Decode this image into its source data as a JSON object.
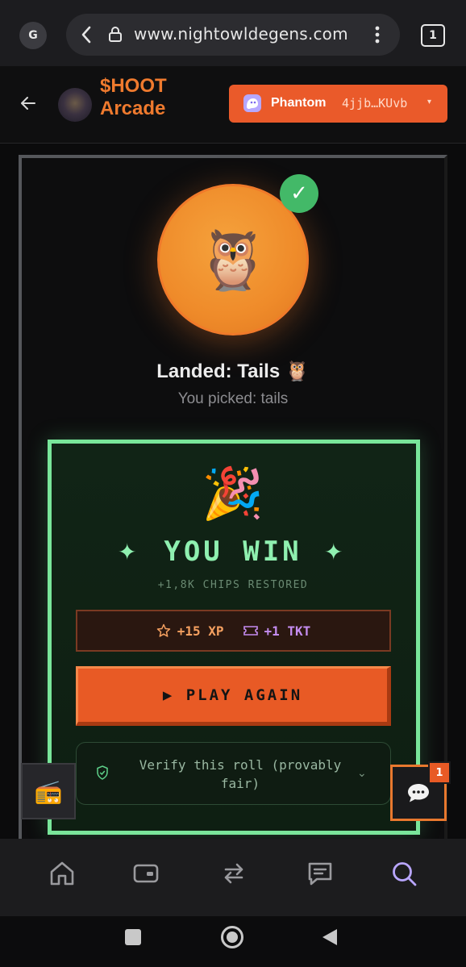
{
  "browser": {
    "profile_initial": "G",
    "url": "www.nightowldegens.com",
    "tab_count": "1"
  },
  "header": {
    "brand_name": "$HOOT\nArcade",
    "wallet_name": "Phantom",
    "wallet_address": "4jjb…KUvb",
    "wallet_caret": "▾"
  },
  "result": {
    "coin_emoji": "🦉",
    "check": "✓",
    "landed_text": "Landed: Tails 🦉",
    "picked_text": "You picked: tails"
  },
  "win": {
    "party_emoji": "🎉",
    "title": "YOU WIN",
    "sparkle": "✦",
    "chips_text": "+1,8K CHIPS RESTORED",
    "xp_text": "+15 XP",
    "tkt_text": "+1 TKT",
    "play_again": "▶ PLAY AGAIN",
    "verify_text": "Verify this roll (provably fair)"
  },
  "floating": {
    "radio_emoji": "📻",
    "chat_badge": "1"
  },
  "colors": {
    "accent_orange": "#ea5a2a",
    "win_green": "#8ff0b0",
    "nav_active": "#b9a6ff"
  },
  "bottom_nav": {
    "items": [
      "home-icon",
      "wallet-icon",
      "swap-icon",
      "messages-icon",
      "search-icon"
    ],
    "active": "search-icon"
  }
}
